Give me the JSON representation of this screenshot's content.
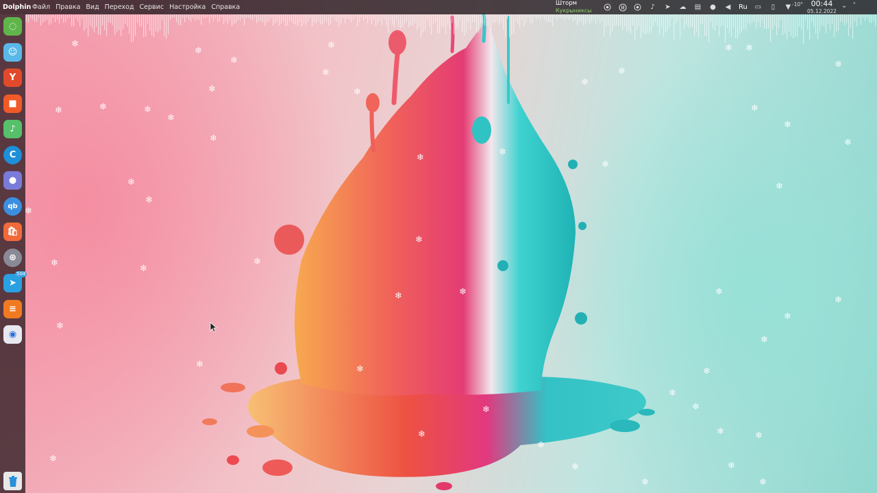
{
  "panel": {
    "app_name": "Dolphin",
    "menus": [
      "Файл",
      "Правка",
      "Вид",
      "Переход",
      "Сервис",
      "Настройка",
      "Справка"
    ],
    "media": {
      "title": "Шторм",
      "artist": "Кукрыниксы"
    },
    "tray": {
      "language": "Ru",
      "temperature": "-10°"
    },
    "clock": {
      "time": "00:44",
      "date": "05.12.2022"
    }
  },
  "dock": {
    "items": [
      {
        "name": "leaf-app-icon",
        "color": "#5fb54a",
        "glyph": "◌"
      },
      {
        "name": "finder-icon",
        "color": "#5ab8e8",
        "glyph": "☺"
      },
      {
        "name": "yandex-browser-icon",
        "color": "#e04a2a",
        "glyph": "Y"
      },
      {
        "name": "video-call-icon",
        "color": "#f05a28",
        "glyph": "■"
      },
      {
        "name": "music-icon",
        "color": "#56c06a",
        "glyph": "♪"
      },
      {
        "name": "browser-c-icon",
        "color": "#1e8fd8",
        "glyph": "C"
      },
      {
        "name": "camera-lens-icon",
        "color": "#7a7ad8",
        "glyph": "●"
      },
      {
        "name": "qbittorrent-icon",
        "color": "#3c8fe0",
        "glyph": "qb"
      },
      {
        "name": "shop-icon",
        "color": "#f26a3a",
        "glyph": "🛍"
      },
      {
        "name": "steering-wheel-icon",
        "color": "#8a8a96",
        "glyph": "⊛"
      },
      {
        "name": "telegram-icon",
        "color": "#2aa0e0",
        "glyph": "➤",
        "badge": "504"
      },
      {
        "name": "sublime-icon",
        "color": "#f07a22",
        "glyph": "≡"
      },
      {
        "name": "screenshot-icon",
        "color": "#e8e8f0",
        "glyph": "◉"
      }
    ]
  }
}
